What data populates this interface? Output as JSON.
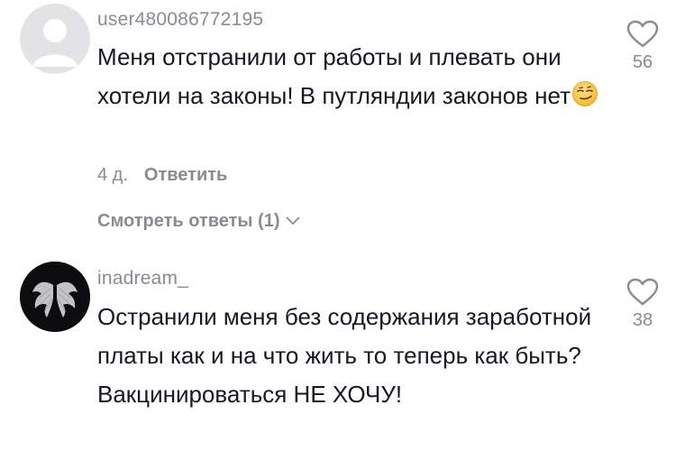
{
  "comments": [
    {
      "username": "user480086772195",
      "text": "Меня отстранили от работы и плевать они хотели на законы! В путляндии законов нет",
      "emoji": "smirking-face",
      "age": "4 д.",
      "reply_label": "Ответить",
      "view_replies_label": "Смотреть ответы (1)",
      "likes": "56"
    },
    {
      "username": "inadream_",
      "text": "Остранили меня без содержания заработной платы как и на что жить то теперь как быть?Вакцинироваться НЕ ХОЧУ!",
      "likes": "38"
    }
  ],
  "colors": {
    "text": "#161823",
    "muted": "#8a8b91",
    "background": "#ffffff"
  }
}
